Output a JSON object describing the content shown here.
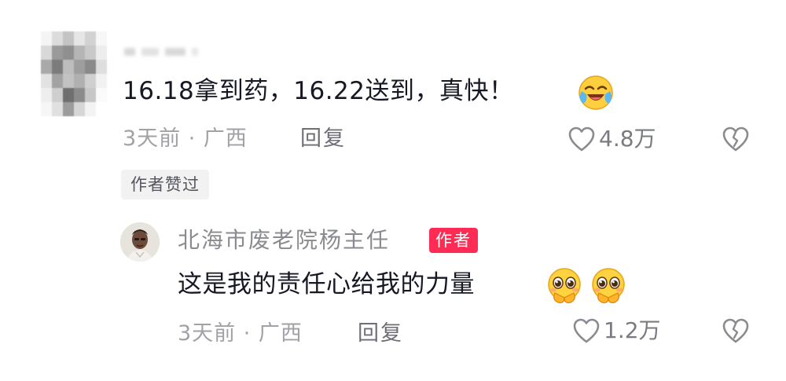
{
  "comment": {
    "text": "16.18拿到药，16.22送到，真快！",
    "time_location": "3天前 · 广西",
    "reply_label": "回复",
    "like_count": "4.8万",
    "author_liked_badge": "作者赞过"
  },
  "reply": {
    "username": "北海市废老院杨主任",
    "author_tag": "作者",
    "text": "这是我的责任心给我的力量",
    "time_location": "3天前 · 广西",
    "reply_label": "回复",
    "like_count": "1.2万"
  },
  "icons": {
    "comment_emoji": "laugh-cry-emoji-icon",
    "reply_emojis": [
      "pleading-emoji-icon",
      "pleading-emoji-icon"
    ],
    "like": "heart-outline-icon",
    "dislike": "broken-heart-outline-icon"
  },
  "colors": {
    "author_tag": "#fe2c55",
    "primary_text": "#161823",
    "secondary_text": "#a1a2a7"
  }
}
